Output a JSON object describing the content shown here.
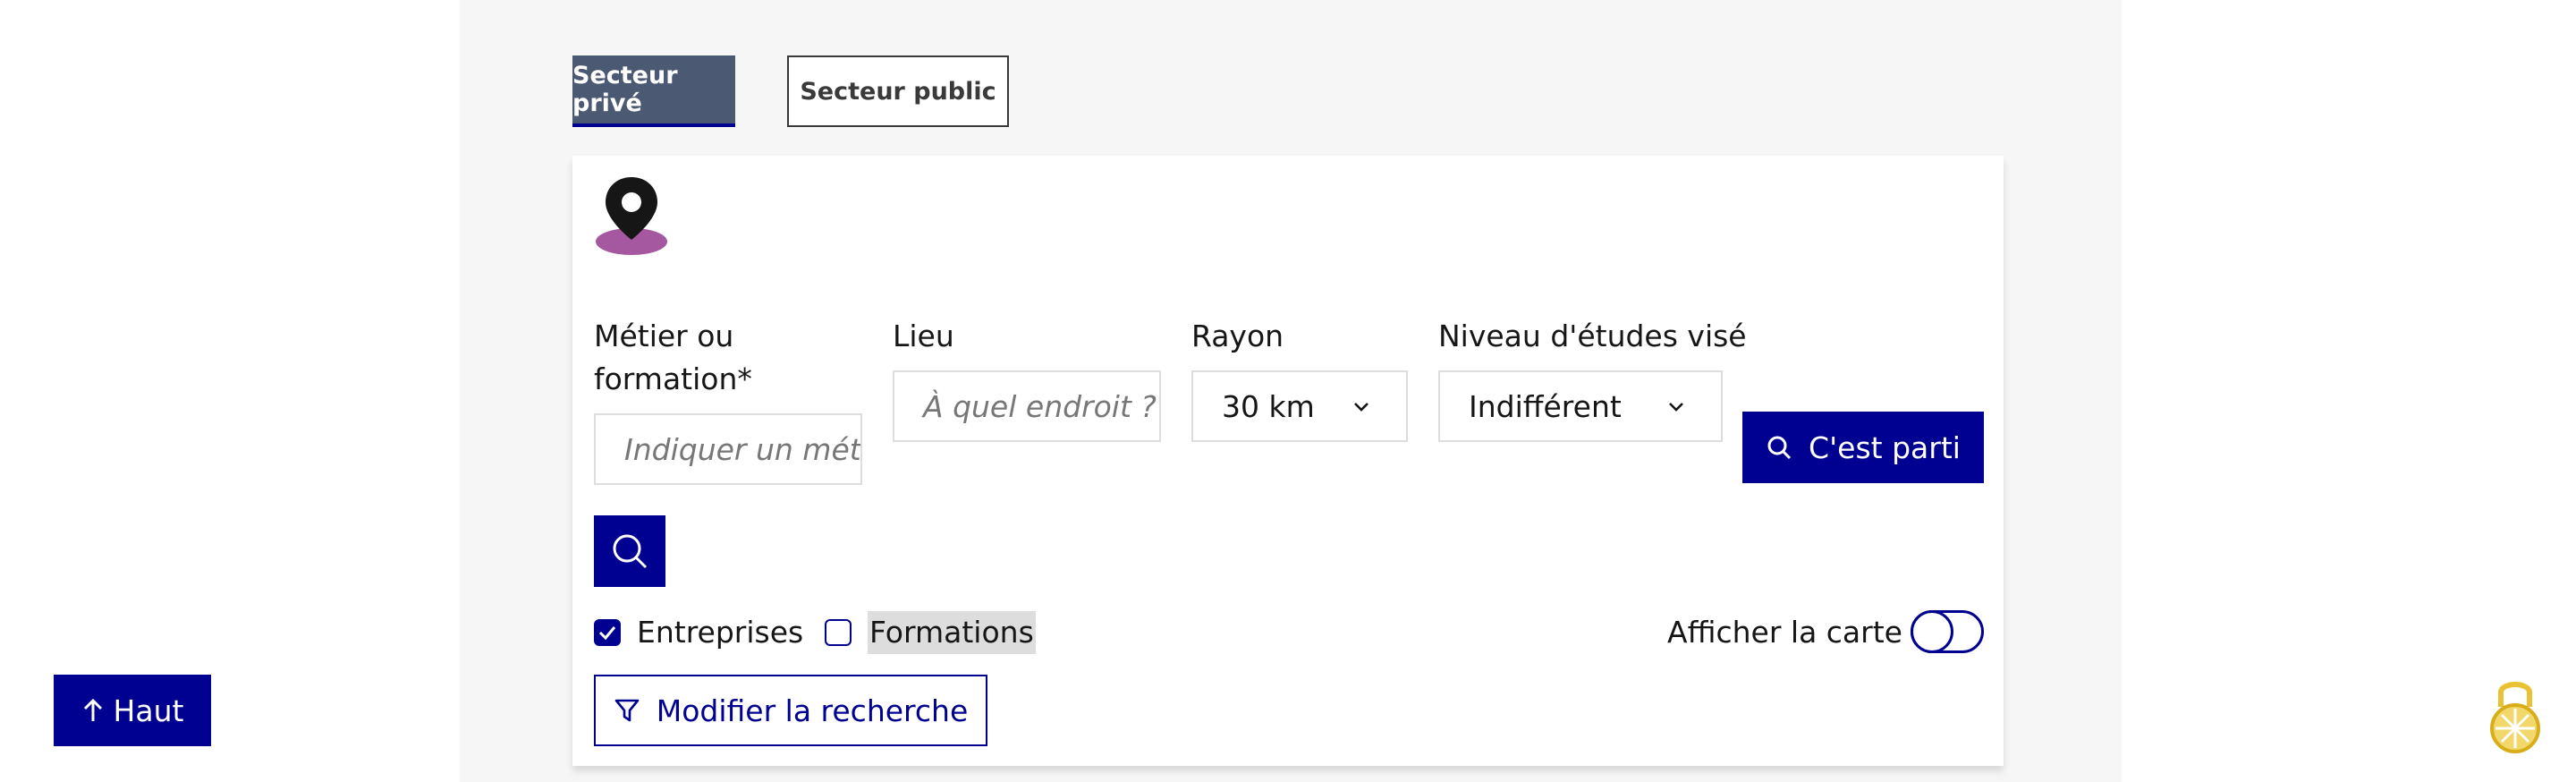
{
  "tabs": [
    {
      "label": "Secteur privé",
      "active": true
    },
    {
      "label": "Secteur public",
      "active": false
    }
  ],
  "form": {
    "metier_label": "Métier ou formation",
    "required_mark": "*",
    "metier_placeholder": "Indiquer un métier ou une formation",
    "lieu_label": "Lieu",
    "lieu_placeholder": "À quel endroit ?",
    "rayon_label": "Rayon",
    "rayon_value": "30 km",
    "niveau_label": "Niveau d'études visé",
    "niveau_value": "Indifférent",
    "submit_label": "C'est parti"
  },
  "filters": {
    "entreprises_label": "Entreprises",
    "entreprises_checked": true,
    "formations_label": "Formations",
    "formations_checked": false
  },
  "map_toggle": {
    "label": "Afficher la carte",
    "on": false
  },
  "modify_label": "Modifier la recherche",
  "back_to_top_label": "Haut",
  "icons": {
    "location": "map-pin-icon",
    "search": "search-icon",
    "filter": "filter-icon",
    "arrow_up": "arrow-up-icon",
    "chevron": "chevron-down-icon",
    "lock": "lock-icon"
  },
  "colors": {
    "primary": "#000091",
    "tab_active_bg": "#4c5973",
    "pin": "#161616",
    "pin_shadow": "#a558a0",
    "highlight": "#dddddd",
    "lock": "#e8c232"
  }
}
